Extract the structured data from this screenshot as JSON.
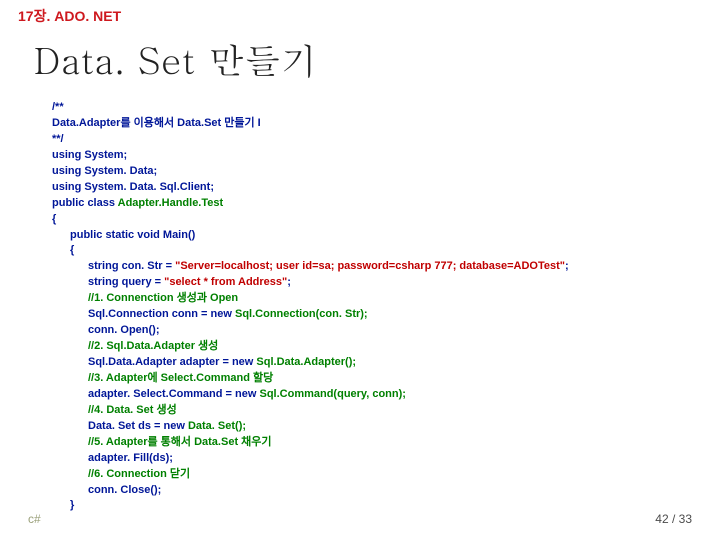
{
  "chapter": "17장. ADO. NET",
  "title": "Data. Set 만들기",
  "code": {
    "l1": "/**",
    "l2": "Data.Adapter를 이용해서 Data.Set 만들기 I",
    "l3": "**/",
    "l4": "using System;",
    "l5": "using System. Data;",
    "l6": "using System. Data. Sql.Client;",
    "l7a": "public class ",
    "l7b": "Adapter.Handle.Test",
    "l8": "{",
    "l9": "public static void Main()",
    "l10": "{",
    "l11a": "string con. Str = ",
    "l11b": "\"Server=localhost; user id=sa; password=csharp 777; database=ADOTest\"",
    "l11c": ";",
    "l12a": "string query = ",
    "l12b": "\"select * from Address\"",
    "l12c": ";",
    "l13": "//1. Connenction 생성과 Open",
    "l14a": "Sql.Connection conn = new ",
    "l14b": "Sql.Connection(con. Str);",
    "l15": "conn. Open();",
    "l16": "//2. Sql.Data.Adapter 생성",
    "l17a": "Sql.Data.Adapter adapter = new ",
    "l17b": "Sql.Data.Adapter();",
    "l18": "//3. Adapter에 Select.Command 할당",
    "l19a": "adapter. Select.Command = new ",
    "l19b": "Sql.Command(query, conn);",
    "l20": "//4. Data. Set 생성",
    "l21a": "Data. Set ds = new ",
    "l21b": "Data. Set();",
    "l22": "//5. Adapter를 통해서 Data.Set 채우기",
    "l23": "adapter. Fill(ds);",
    "l24": "//6. Connection 닫기",
    "l25": "conn. Close();",
    "l26": "}"
  },
  "footer": {
    "left": "c#",
    "right": "42 / 33"
  }
}
